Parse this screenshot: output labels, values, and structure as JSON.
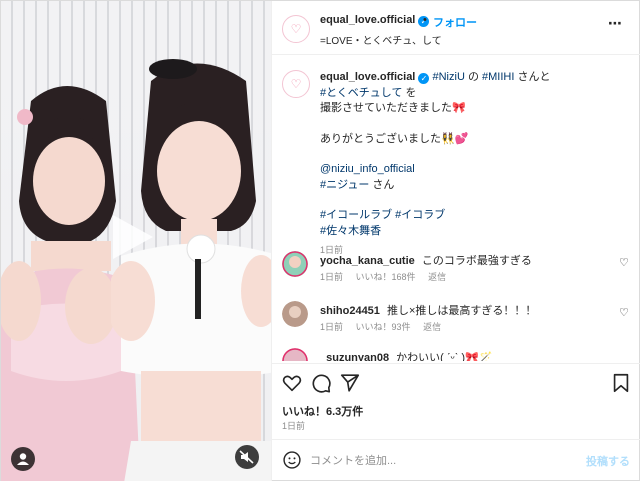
{
  "colors": {
    "accent": "#0095f6",
    "link": "#00376b",
    "muted": "#8e8e8e",
    "brand_pink": "#f08aa6"
  },
  "header": {
    "username": "equal_love.official",
    "separator": "•",
    "follow_label": "フォロー",
    "subtitle": "=LOVE・とくベチュ、して",
    "more_icon": "⋯"
  },
  "caption": {
    "username": "equal_love.official",
    "tag_niziu": "#NiziU",
    "text_no": "の",
    "tag_miihi": "#MIIHI",
    "text_san_to": "さんと",
    "tag_tokubechu": "#とくベチュして",
    "text_wo": "を",
    "line2": "撮影させていただきました🎀",
    "line3": "ありがとうございました👯‍♀️💕",
    "mention": "@niziu_info_official",
    "tag_niju": "#ニジュー",
    "text_san": "さん",
    "tags_line1": "#イコールラブ #イコラブ",
    "tags_line2": "#佐々木舞香",
    "time": "1日前"
  },
  "comments": [
    {
      "username": "yocha_kana_cutie",
      "text": "このコラボ最強すぎる",
      "time": "1日前",
      "likes": "いいね！168件",
      "reply": "返信"
    },
    {
      "username": "shiho24451",
      "text": "推し×推しは最高すぎる！！！",
      "time": "1日前",
      "likes": "いいね！93件",
      "reply": "返信"
    },
    {
      "username": "_suzunyan08",
      "text": "かわいい( ˊᵕˋ )🎀🪄",
      "time": "",
      "likes": "",
      "reply": ""
    }
  ],
  "like_icon": "♡",
  "post_stats": {
    "likes": "いいね！6.3万件",
    "date": "1日前"
  },
  "composer": {
    "placeholder": "コメントを追加...",
    "post_label": "投稿する"
  }
}
